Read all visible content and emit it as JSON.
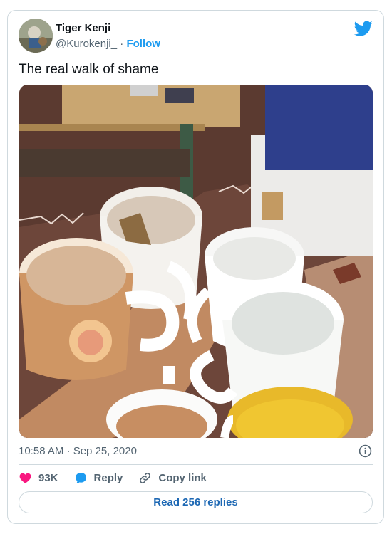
{
  "author": {
    "display_name": "Tiger Kenji",
    "handle": "@Kurokenji_",
    "separator": "·",
    "follow_label": "Follow"
  },
  "tweet": {
    "text": "The real walk of shame",
    "timestamp": "10:58 AM · Sep 25, 2020"
  },
  "actions": {
    "likes": "93K",
    "reply_label": "Reply",
    "copy_label": "Copy link"
  },
  "read_replies_label": "Read 256 replies",
  "colors": {
    "brand_blue": "#1d9bf0",
    "like_red": "#f91880",
    "text_secondary": "#536471",
    "border": "#cfd9de"
  },
  "icons": [
    "twitter-bird-icon",
    "info-icon",
    "heart-icon",
    "reply-icon",
    "link-icon"
  ]
}
